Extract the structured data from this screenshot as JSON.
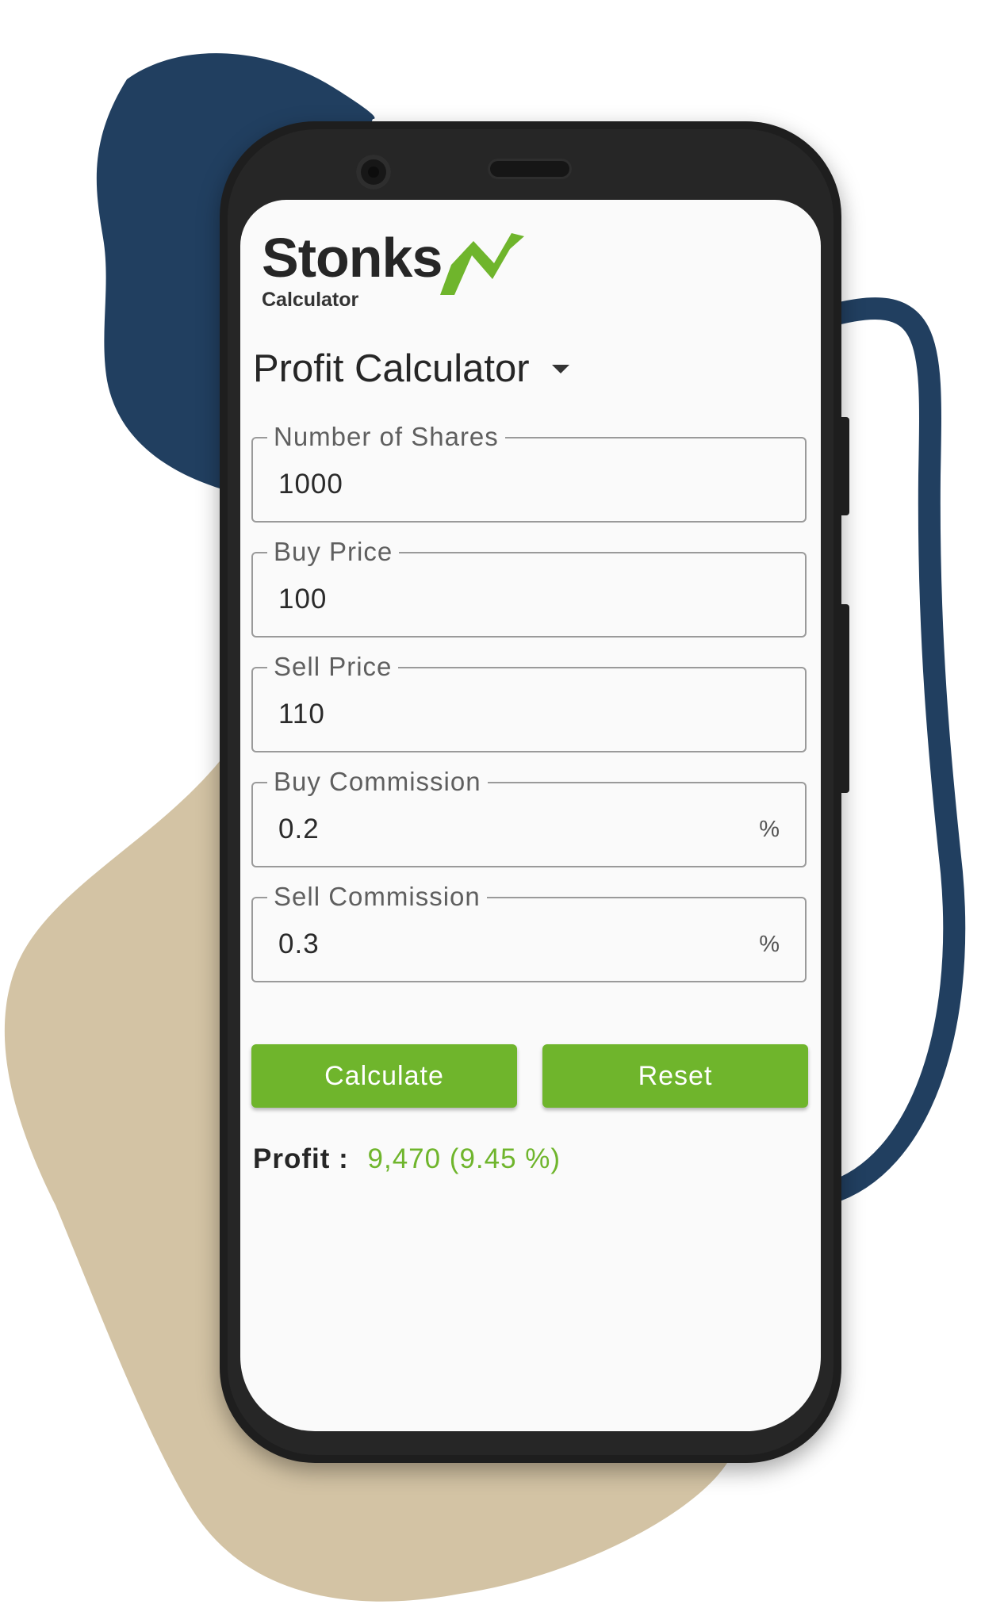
{
  "app": {
    "logo_word": "Stonks",
    "logo_sub": "Calculator",
    "calculator_type": "Profit Calculator"
  },
  "fields": [
    {
      "label": "Number of Shares",
      "value": "1000",
      "suffix": ""
    },
    {
      "label": "Buy Price",
      "value": "100",
      "suffix": ""
    },
    {
      "label": "Sell Price",
      "value": "110",
      "suffix": ""
    },
    {
      "label": "Buy Commission",
      "value": "0.2",
      "suffix": "%"
    },
    {
      "label": "Sell Commission",
      "value": "0.3",
      "suffix": "%"
    }
  ],
  "buttons": {
    "calculate": "Calculate",
    "reset": "Reset"
  },
  "result": {
    "label": "Profit :",
    "value": "9,470 (9.45 %)"
  },
  "colors": {
    "accent": "#6fb52c",
    "blob_navy": "#213f60",
    "blob_sand": "#d3c3a4",
    "phone_frame": "#1e1e1e"
  }
}
